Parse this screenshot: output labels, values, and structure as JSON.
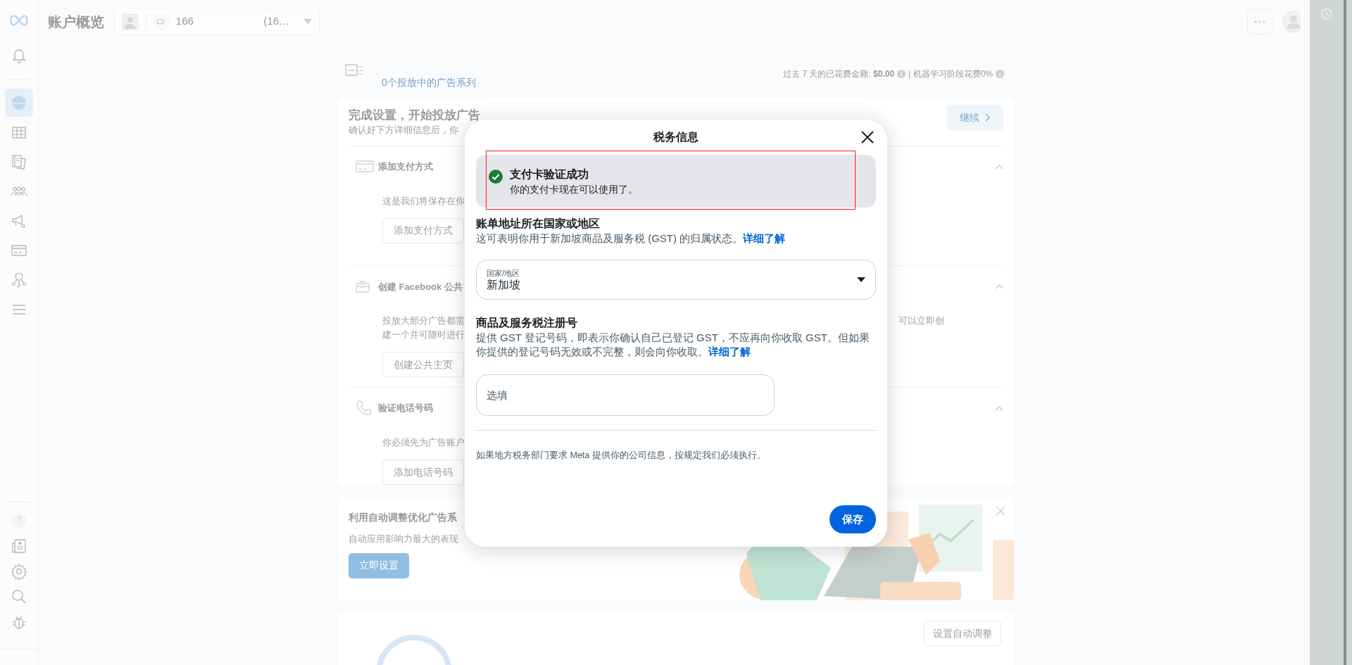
{
  "header": {
    "title": "账户概览",
    "account_id": "166",
    "account_suffix": "(16…"
  },
  "sidebar": {
    "top_items": [
      {
        "kind": "bell",
        "selected": false
      }
    ],
    "items": [
      {
        "kind": "globe",
        "selected": true
      },
      {
        "kind": "table",
        "selected": false
      },
      {
        "kind": "pages",
        "selected": false
      },
      {
        "kind": "audience",
        "selected": false
      },
      {
        "kind": "megaphone",
        "selected": false
      },
      {
        "kind": "card",
        "selected": false
      },
      {
        "kind": "network",
        "selected": false
      },
      {
        "kind": "menu",
        "selected": false
      }
    ],
    "bottom_items": [
      {
        "kind": "help",
        "selected": false
      },
      {
        "kind": "news",
        "selected": false
      },
      {
        "kind": "settings",
        "selected": false
      },
      {
        "kind": "search",
        "selected": false
      },
      {
        "kind": "bug",
        "selected": false
      }
    ]
  },
  "summary": {
    "campaign_count": "0个投放中的广告系列",
    "spend": "过去 7 天的已花费金额: **$0.00**",
    "ml_spend": "| 机器学习阶段花费0%"
  },
  "setup_card": {
    "title": "完成设置，开始投放广告",
    "subtitle": "确认好下方详细信息后，你",
    "continue_button": "继续",
    "steps": [
      {
        "kind": "card",
        "title": "添加支付方式",
        "lines": [
          "这是我们将保存在你"
        ],
        "button": "添加支付方式"
      },
      {
        "kind": "page",
        "title": "创建 Facebook 公共",
        "lines": [
          "投放大部分广告都需",
          "建一个并可随时进行"
        ],
        "trailing_text": "可以立即创",
        "button": "创建公共主页"
      },
      {
        "kind": "phone",
        "title": "验证电话号码",
        "lines": [
          "你必须先为广告账户"
        ],
        "button": "添加电话号码"
      }
    ]
  },
  "promo": {
    "title": "利用自动调整优化广告系",
    "description": "自动应用影响力最大的表现",
    "button": "立即设置"
  },
  "autotune": {
    "button": "设置自动调整"
  },
  "dialog": {
    "title": "税务信息",
    "notice": {
      "kind": "success",
      "title": "支付卡验证成功",
      "message": "你的支付卡现在可以使用了。"
    },
    "country_section": {
      "heading": "账单地址所在国家或地区",
      "description": "这可表明你用于新加坡商品及服务税 (GST) 的归属状态。",
      "link": "详细了解",
      "select_label": "国家/地区",
      "select_value": "新加坡"
    },
    "gst_section": {
      "heading": "商品及服务税注册号",
      "description": "提供 GST 登记号码，即表示你确认自己已登记 GST，不应再向你收取 GST。但如果你提供的登记号码无效或不完整，则会向你收取。",
      "link": "详细了解",
      "placeholder": "选填"
    },
    "footer_note": "如果地方税务部门要求 Meta 提供你的公司信息，按规定我们必须执行。",
    "save_button": "保存"
  }
}
